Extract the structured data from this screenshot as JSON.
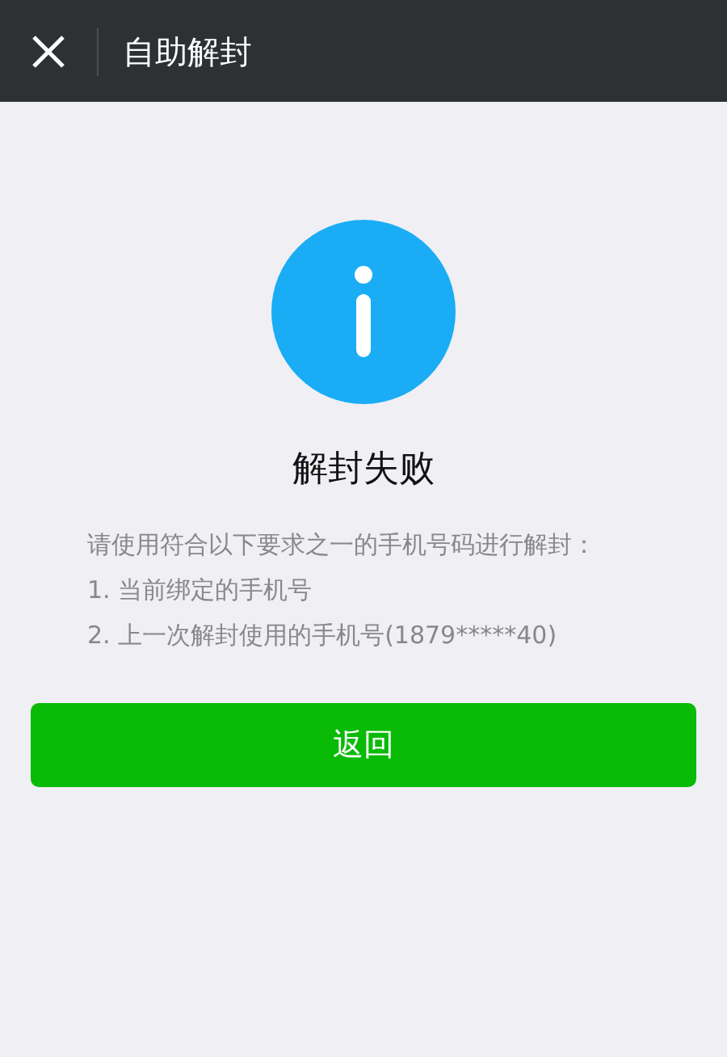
{
  "header": {
    "title": "自助解封"
  },
  "result": {
    "title": "解封失败",
    "lines": [
      "请使用符合以下要求之一的手机号码进行解封：",
      "1. 当前绑定的手机号",
      "2. 上一次解封使用的手机号(1879*****40)"
    ]
  },
  "buttons": [
    "返回"
  ]
}
